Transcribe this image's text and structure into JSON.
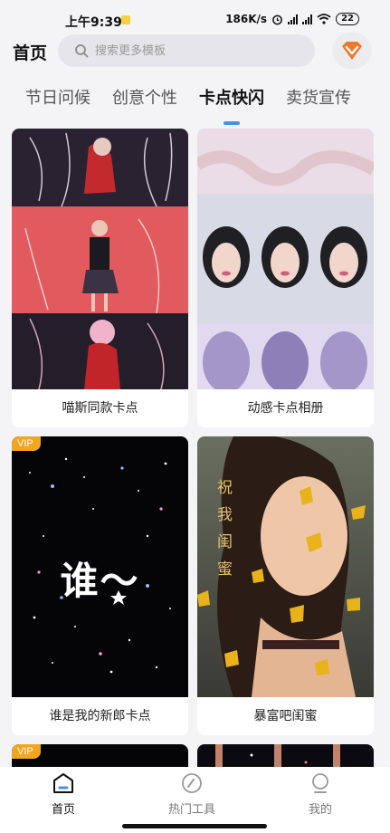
{
  "status": {
    "time": "上午9:39",
    "net_speed": "186K/s",
    "battery": "22"
  },
  "header": {
    "title": "首页",
    "search_placeholder": "搜索更多模板"
  },
  "tabs": [
    {
      "label": "节日问候",
      "active": false
    },
    {
      "label": "创意个性",
      "active": false
    },
    {
      "label": "卡点快闪",
      "active": true
    },
    {
      "label": "卖货宣传",
      "active": false
    }
  ],
  "cards": [
    {
      "title": "喵斯同款卡点",
      "vip": false
    },
    {
      "title": "动感卡点相册",
      "vip": false
    },
    {
      "title": "谁是我的新郎卡点",
      "vip": true,
      "art_text": "谁～"
    },
    {
      "title": "暴富吧闺蜜",
      "vip": false,
      "art_text": "祝我闺蜜"
    },
    {
      "title": "",
      "vip": true
    },
    {
      "title": "",
      "vip": false
    }
  ],
  "vip_label": "VIP",
  "bottom_nav": [
    {
      "label": "首页",
      "icon": "home-icon",
      "active": true
    },
    {
      "label": "热门工具",
      "icon": "compass-icon",
      "active": false
    },
    {
      "label": "我的",
      "icon": "profile-icon",
      "active": false
    }
  ],
  "colors": {
    "accent": "#4a90e2",
    "vip": "#f2a61f",
    "vip_badge": "#f0782a"
  }
}
